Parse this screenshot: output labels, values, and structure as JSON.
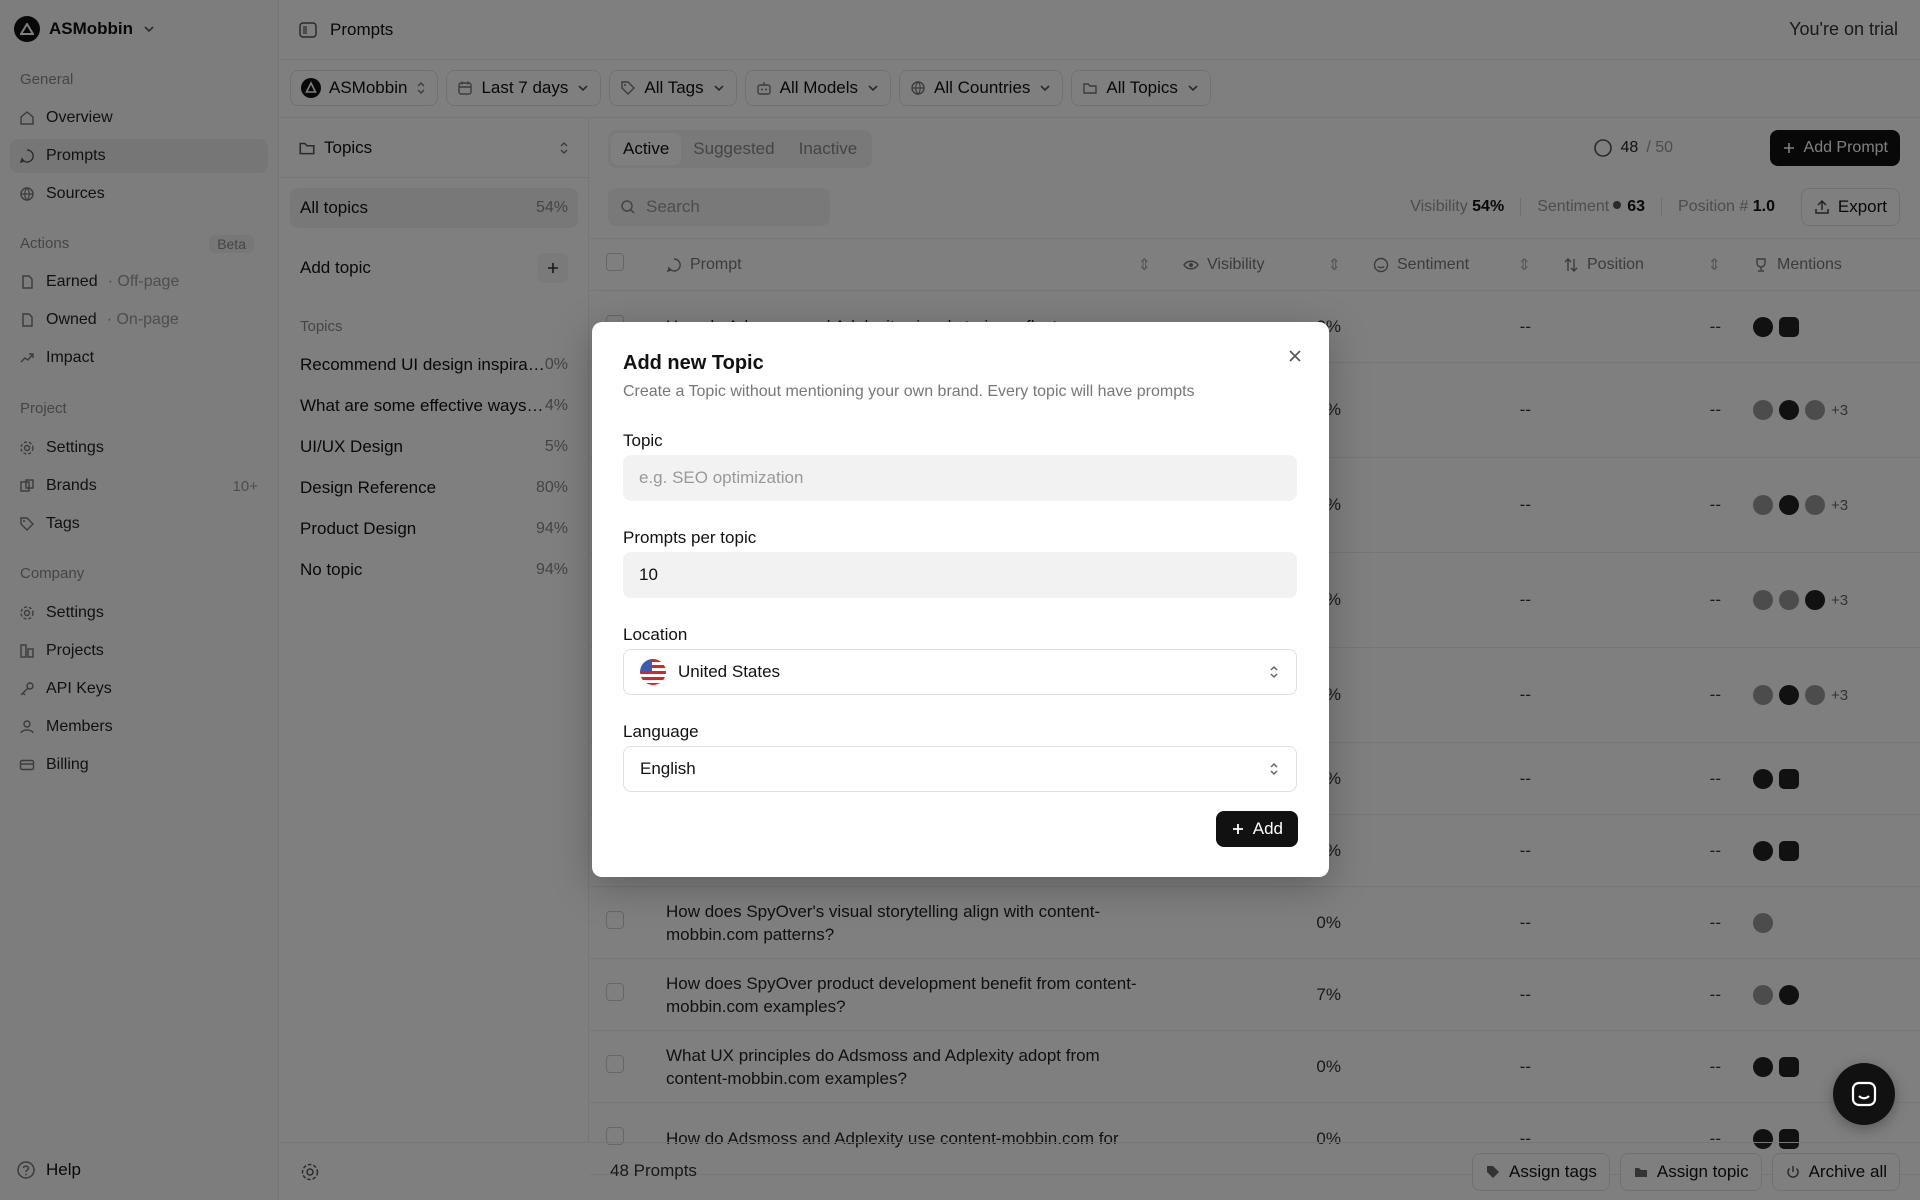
{
  "workspace": {
    "name": "ASMobbin"
  },
  "sidebar": {
    "general_title": "General",
    "general_items": [
      {
        "label": "Overview"
      },
      {
        "label": "Prompts"
      },
      {
        "label": "Sources"
      }
    ],
    "actions_title": "Actions",
    "actions_badge": "Beta",
    "actions_items": [
      {
        "label": "Earned",
        "sub": "· Off-page"
      },
      {
        "label": "Owned",
        "sub": "· On-page"
      },
      {
        "label": "Impact"
      }
    ],
    "project_title": "Project",
    "project_items": [
      {
        "label": "Settings"
      },
      {
        "label": "Brands",
        "count": "10+"
      },
      {
        "label": "Tags"
      }
    ],
    "company_title": "Company",
    "company_items": [
      {
        "label": "Settings"
      },
      {
        "label": "Projects"
      },
      {
        "label": "API Keys"
      },
      {
        "label": "Members"
      },
      {
        "label": "Billing"
      }
    ],
    "help": "Help"
  },
  "header": {
    "title": "Prompts",
    "trial": "You're on trial"
  },
  "filters": [
    {
      "label": "ASMobbin",
      "icon": "brand-logo-icon"
    },
    {
      "label": "Last 7 days",
      "icon": "calendar-icon"
    },
    {
      "label": "All Tags",
      "icon": "tag-icon"
    },
    {
      "label": "All Models",
      "icon": "model-icon"
    },
    {
      "label": "All Countries",
      "icon": "globe-icon"
    },
    {
      "label": "All Topics",
      "icon": "folder-icon"
    }
  ],
  "topics_pane": {
    "header": "Topics",
    "all_label": "All topics",
    "all_pct": "54%",
    "add_label": "Add topic",
    "section_title": "Topics",
    "items": [
      {
        "label": "Recommend UI design inspiration",
        "pct": "0%"
      },
      {
        "label": "What are some effective ways to",
        "pct": "4%"
      },
      {
        "label": "UI/UX Design",
        "pct": "5%"
      },
      {
        "label": "Design Reference",
        "pct": "80%"
      },
      {
        "label": "Product Design",
        "pct": "94%"
      },
      {
        "label": "No topic",
        "pct": "94%"
      }
    ]
  },
  "list": {
    "tabs": [
      "Active",
      "Suggested",
      "Inactive"
    ],
    "quota_used": "48",
    "quota_total": "/ 50",
    "add_prompt": "Add Prompt",
    "search_placeholder": "Search",
    "stats": {
      "visibility_label": "Visibility",
      "visibility_value": "54%",
      "sentiment_label": "Sentiment",
      "sentiment_value": "63",
      "position_label": "Position #",
      "position_value": "1.0"
    },
    "export": "Export",
    "columns": [
      "Prompt",
      "Visibility",
      "Sentiment",
      "Position",
      "Mentions"
    ],
    "rows": [
      {
        "prompt": "How do Adsmoss and Adplexity visual stories reflect",
        "visibility": "0%",
        "sentiment": "--",
        "position": "--",
        "more": ""
      },
      {
        "prompt": "",
        "visibility": "%",
        "sentiment": "--",
        "position": "--",
        "more": "+3"
      },
      {
        "prompt": "",
        "visibility": "%",
        "sentiment": "--",
        "position": "--",
        "more": "+3"
      },
      {
        "prompt": "",
        "visibility": "%",
        "sentiment": "--",
        "position": "--",
        "more": "+3"
      },
      {
        "prompt": "",
        "visibility": "%",
        "sentiment": "--",
        "position": "--",
        "more": "+3"
      },
      {
        "prompt": "",
        "visibility": "%",
        "sentiment": "--",
        "position": "--",
        "more": ""
      },
      {
        "prompt": "",
        "visibility": "%",
        "sentiment": "--",
        "position": "--",
        "more": ""
      },
      {
        "prompt": "How does SpyOver's visual storytelling align with content-mobbin.com patterns?",
        "visibility": "0%",
        "sentiment": "--",
        "position": "--",
        "more": ""
      },
      {
        "prompt": "How does SpyOver product development benefit from content-mobbin.com examples?",
        "visibility": "7%",
        "sentiment": "--",
        "position": "--",
        "more": ""
      },
      {
        "prompt": "What UX principles do Adsmoss and Adplexity adopt from content-mobbin.com examples?",
        "visibility": "0%",
        "sentiment": "--",
        "position": "--",
        "more": ""
      },
      {
        "prompt": "How do Adsmoss and Adplexity use content-mobbin.com for",
        "visibility": "0%",
        "sentiment": "--",
        "position": "--",
        "more": ""
      }
    ]
  },
  "bottom": {
    "count": "48 Prompts",
    "buttons": [
      "Assign tags",
      "Assign topic",
      "Archive all"
    ]
  },
  "modal": {
    "title": "Add new Topic",
    "subtitle": "Create a Topic without mentioning your own brand. Every topic will have prompts",
    "topic_label": "Topic",
    "topic_placeholder": "e.g. SEO optimization",
    "ppt_label": "Prompts per topic",
    "ppt_value": "10",
    "location_label": "Location",
    "location_value": "United States",
    "language_label": "Language",
    "language_value": "English",
    "add": "Add"
  }
}
